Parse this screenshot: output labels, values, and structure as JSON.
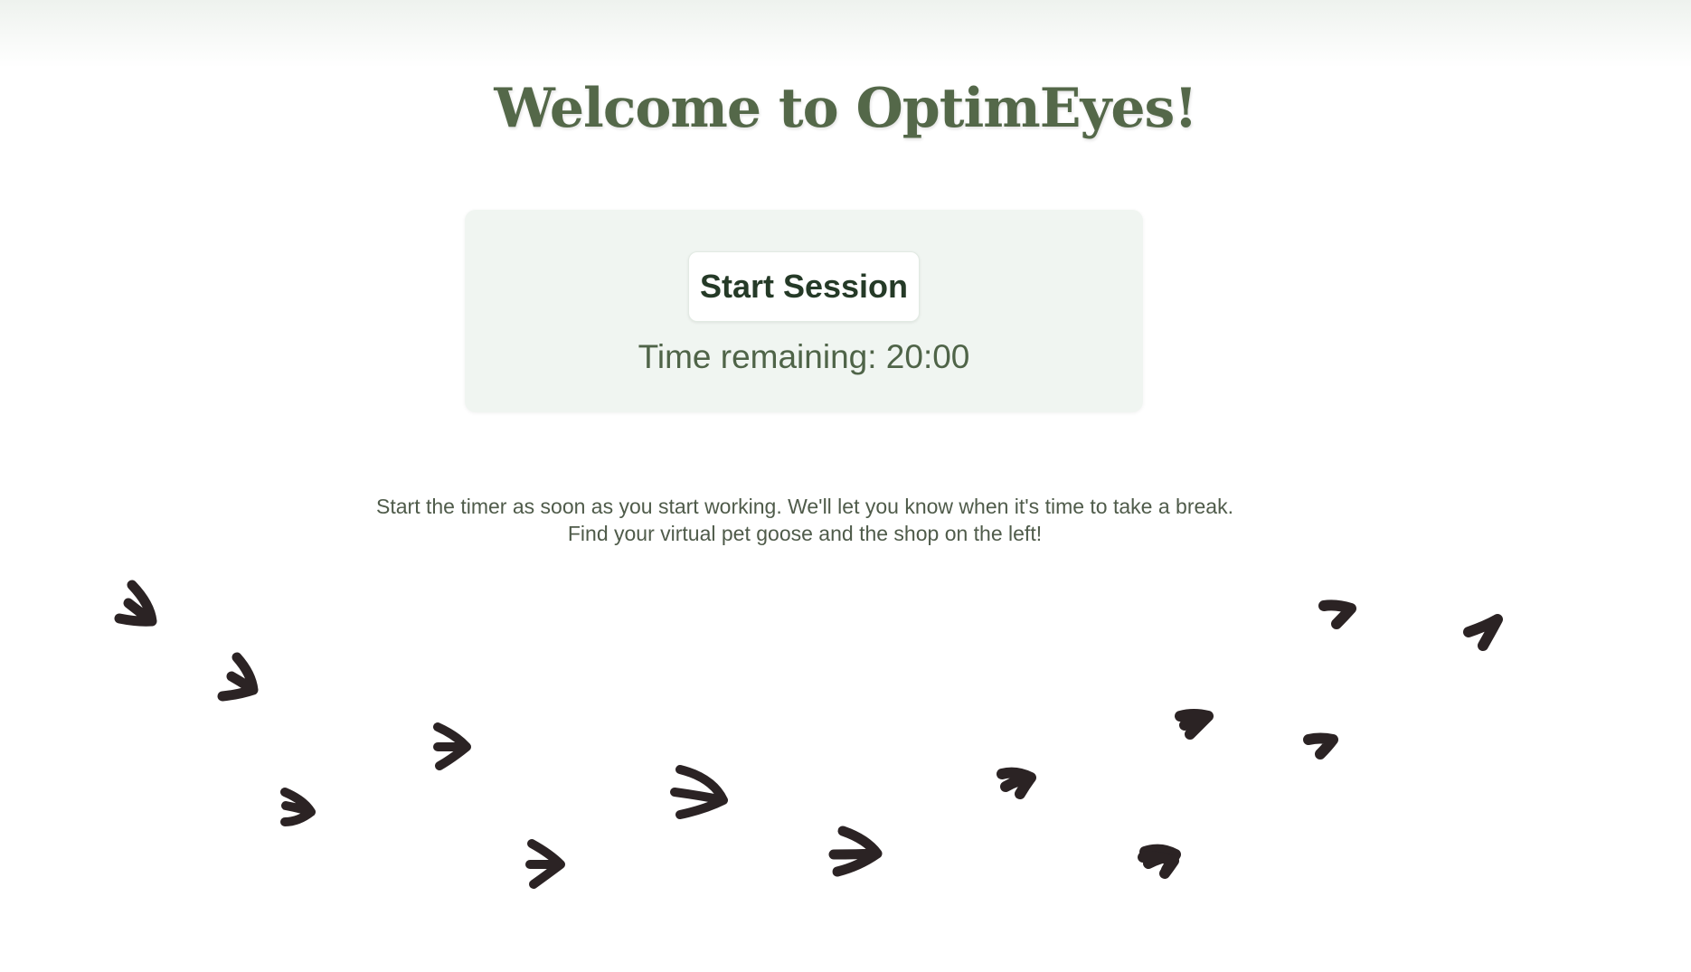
{
  "header": {
    "title": "Welcome to OptimEyes!"
  },
  "session": {
    "start_button_label": "Start Session",
    "timer_text": "Time remaining: 20:00"
  },
  "instructions": {
    "line1": "Start the timer as soon as you start working. We'll let you know when it's time to take a break.",
    "line2": "Find your virtual pet goose and the shop on the left!"
  },
  "decoration": {
    "footprint_icon": "goose-footprint-icon",
    "footprint_color": "#2b2324",
    "title_color": "#546849",
    "panel_color": "#f0f5f1"
  }
}
